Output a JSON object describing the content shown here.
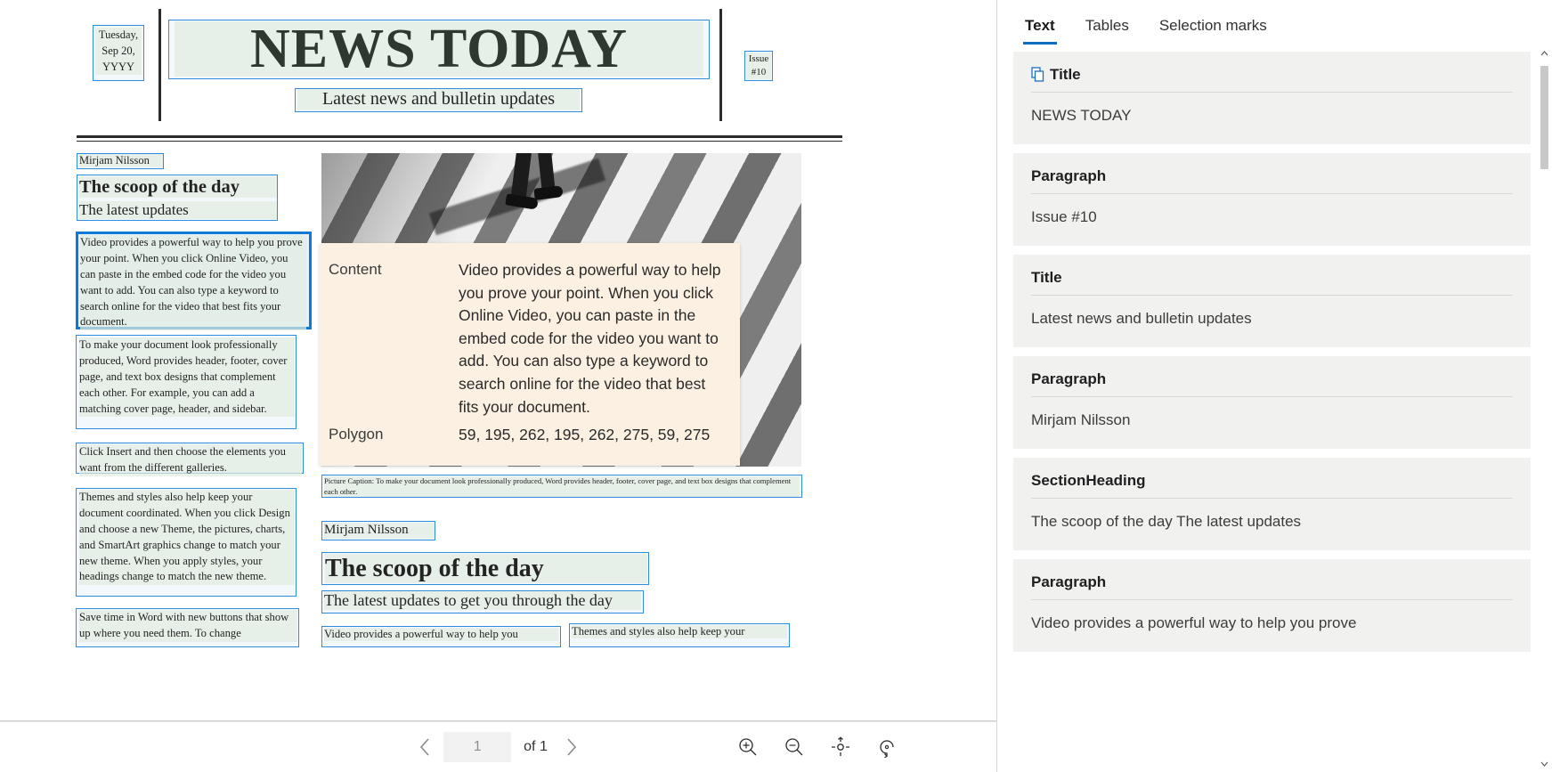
{
  "document": {
    "masthead": {
      "date": "Tuesday, Sep 20, YYYY",
      "title": "NEWS TODAY",
      "subtitle": "Latest news and bulletin updates",
      "issue": "Issue #10"
    },
    "left_column": {
      "byline": "Mirjam Nilsson",
      "heading": "The scoop of the day",
      "subheading": "The latest updates",
      "paragraphs": [
        "Video provides a powerful way to help you prove your point. When you click Online Video, you can paste in the embed code for the video you want to add. You can also type a keyword to search online for the video that best fits your document.",
        "To make your document look professionally produced, Word provides header, footer, cover page, and text box designs that complement each other. For example, you can add a matching cover page, header, and sidebar.",
        "Click Insert and then choose the elements you want from the different galleries.",
        "Themes and styles also help keep your document coordinated. When you click Design and choose a new Theme, the pictures, charts, and SmartArt graphics change to match your new theme. When you apply styles, your headings change to match the new theme.",
        "Save time in Word with new buttons that show up where you need them. To change"
      ]
    },
    "caption": "Picture Caption: To make your document look professionally produced, Word provides header, footer, cover page, and text box designs that complement each other.",
    "second_section": {
      "byline": "Mirjam Nilsson",
      "heading": "The scoop of the day",
      "subheading": "The latest updates to get you through the day",
      "col_left_snippet": "Video provides a powerful way to help you",
      "col_right_snippet": "Themes and styles also help keep your"
    }
  },
  "tooltip": {
    "rows": [
      {
        "key": "Content",
        "value": "Video provides a powerful way to help you prove your point. When you click Online Video, you can paste in the embed code for the video you want to add. You can also type a keyword to search online for the video that best fits your document."
      },
      {
        "key": "Polygon",
        "value": "59, 195, 262, 195, 262, 275, 59, 275"
      }
    ],
    "background_color": "#fbf0e2"
  },
  "toolbar": {
    "prev_icon": "chevron-left-icon",
    "next_icon": "chevron-right-icon",
    "page_value": "1",
    "page_placeholder": "1",
    "of_label": "of 1",
    "zoom_in_icon": "zoom-in-icon",
    "zoom_out_icon": "zoom-out-icon",
    "fit_icon": "fit-to-page-icon",
    "rotate_icon": "rotate-icon"
  },
  "results_pane": {
    "tabs": [
      {
        "label": "Text",
        "active": true
      },
      {
        "label": "Tables",
        "active": false
      },
      {
        "label": "Selection marks",
        "active": false
      }
    ],
    "cards": [
      {
        "type": "Title",
        "icon": "copy-icon",
        "content": "NEWS TODAY"
      },
      {
        "type": "Paragraph",
        "icon": "",
        "content": "Issue #10"
      },
      {
        "type": "Title",
        "icon": "",
        "content": "Latest news and bulletin updates"
      },
      {
        "type": "Paragraph",
        "icon": "",
        "content": "Mirjam Nilsson"
      },
      {
        "type": "SectionHeading",
        "icon": "",
        "content": "The scoop of the day The latest updates"
      },
      {
        "type": "Paragraph",
        "icon": "",
        "content": "Video provides a powerful way to help you prove"
      }
    ]
  },
  "colors": {
    "accent": "#0f6cbd",
    "card_bg": "#f1f1f0",
    "ocr_box": "#2e8ddf",
    "ocr_box_selected": "#0f7ad6",
    "tooltip_bg": "#fbf0e2"
  }
}
